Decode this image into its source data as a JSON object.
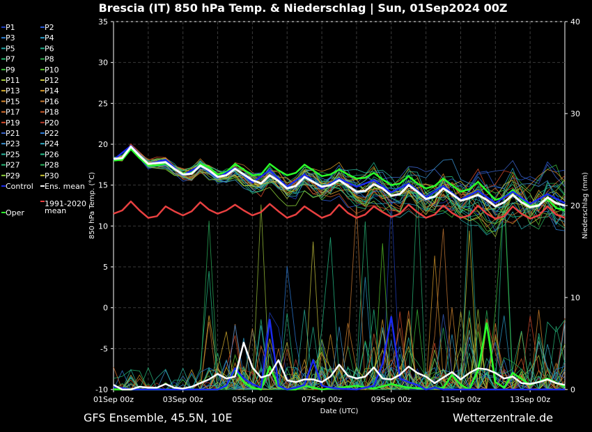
{
  "chart_data": {
    "type": "line",
    "title": "Brescia  (IT)  850 hPa Temp. & Niederschlag | Sun, 01Sep2024 00Z",
    "xlabel": "Date (UTC)",
    "ylabel": "850 hPa Temp. (°C)",
    "y2label": "Niederschlag (mm)",
    "footer_left": "GFS Ensemble, 45.5N, 10E",
    "footer_right": "Wetterzentrale.de",
    "x_ticks": [
      "01Sep 00z",
      "03Sep 00z",
      "05Sep 00z",
      "07Sep 00z",
      "09Sep 00z",
      "11Sep 00z",
      "13Sep 00z"
    ],
    "y_ticks": [
      "35",
      "30",
      "25",
      "20",
      "15",
      "10",
      "5",
      "0",
      "-5",
      "-10"
    ],
    "y2_ticks": [
      "40",
      "30",
      "20",
      "10",
      "0"
    ],
    "ylim": [
      -10,
      35
    ],
    "y2lim": [
      0,
      40
    ],
    "grid": true,
    "legend": [
      {
        "name": "P1",
        "color": "#1f3fbf"
      },
      {
        "name": "P2",
        "color": "#2a5ad8"
      },
      {
        "name": "P3",
        "color": "#2e7fd6"
      },
      {
        "name": "P4",
        "color": "#2a9bc8"
      },
      {
        "name": "P5",
        "color": "#23a8a8"
      },
      {
        "name": "P6",
        "color": "#22b28c"
      },
      {
        "name": "P7",
        "color": "#26b870"
      },
      {
        "name": "P8",
        "color": "#2aa84a"
      },
      {
        "name": "P9",
        "color": "#3cc23c"
      },
      {
        "name": "P10",
        "color": "#5ac82a"
      },
      {
        "name": "P11",
        "color": "#9cc43a"
      },
      {
        "name": "P12",
        "color": "#c4c23c"
      },
      {
        "name": "P13",
        "color": "#d8b030"
      },
      {
        "name": "P14",
        "color": "#d89a2a"
      },
      {
        "name": "P15",
        "color": "#d8882e"
      },
      {
        "name": "P16",
        "color": "#c87a34"
      },
      {
        "name": "P17",
        "color": "#d8702e"
      },
      {
        "name": "P18",
        "color": "#c85a2a"
      },
      {
        "name": "P19",
        "color": "#d84a2a"
      },
      {
        "name": "P20",
        "color": "#b83a2a"
      },
      {
        "name": "P21",
        "color": "#3a62c8"
      },
      {
        "name": "P22",
        "color": "#2a7ad8"
      },
      {
        "name": "P23",
        "color": "#3a90d0"
      },
      {
        "name": "P24",
        "color": "#30a8c0"
      },
      {
        "name": "P25",
        "color": "#2ab8a0"
      },
      {
        "name": "P26",
        "color": "#26c08a"
      },
      {
        "name": "P27",
        "color": "#28b878"
      },
      {
        "name": "P28",
        "color": "#2ab05a"
      },
      {
        "name": "P29",
        "color": "#8cd03a"
      },
      {
        "name": "P30",
        "color": "#c8c030"
      },
      {
        "name": "Control",
        "color": "#1a2af0"
      },
      {
        "name": "Ens. mean",
        "color": "#ffffff"
      },
      {
        "name": "Oper",
        "color": "#2aff2a"
      },
      {
        "name": "1991-2020 mean",
        "color": "#e84040"
      }
    ],
    "series": [
      {
        "name": "Ens. mean",
        "color": "#ffffff",
        "axis": "temp",
        "x": [
          0,
          0.25,
          0.5,
          0.75,
          1,
          1.25,
          1.5,
          1.75,
          2,
          2.25,
          2.5,
          2.75,
          3,
          3.25,
          3.5,
          3.75,
          4,
          4.25,
          4.5,
          4.75,
          5,
          5.25,
          5.5,
          5.75,
          6,
          6.25,
          6.5,
          6.75,
          7,
          7.25,
          7.5,
          7.75,
          8,
          8.25,
          8.5,
          8.75,
          9,
          9.25,
          9.5,
          9.75,
          10,
          10.25,
          10.5,
          10.75,
          11,
          11.25,
          11.5,
          11.75,
          12,
          12.25,
          12.5,
          12.75,
          13
        ],
        "values": [
          18.2,
          18.3,
          19.7,
          18.6,
          17.6,
          17.7,
          17.8,
          17,
          16.3,
          16.4,
          17.4,
          16.8,
          16,
          16.2,
          17,
          16.3,
          15.6,
          15.2,
          16.2,
          15.5,
          14.6,
          14.9,
          16,
          15.4,
          14.8,
          15,
          15.6,
          14.9,
          14.2,
          14.3,
          15.1,
          14.6,
          13.7,
          13.9,
          15,
          14.2,
          13.3,
          13.6,
          14.6,
          13.9,
          13.1,
          13.4,
          13.8,
          13.2,
          12.4,
          12.9,
          13.8,
          12.9,
          12.3,
          12.5,
          13.5,
          12.8,
          12.5
        ]
      },
      {
        "name": "1991-2020 mean",
        "color": "#e84040",
        "axis": "temp",
        "x": [
          0,
          0.25,
          0.5,
          0.75,
          1,
          1.25,
          1.5,
          1.75,
          2,
          2.25,
          2.5,
          2.75,
          3,
          3.25,
          3.5,
          3.75,
          4,
          4.25,
          4.5,
          4.75,
          5,
          5.25,
          5.5,
          5.75,
          6,
          6.25,
          6.5,
          6.75,
          7,
          7.25,
          7.5,
          7.75,
          8,
          8.25,
          8.5,
          8.75,
          9,
          9.25,
          9.5,
          9.75,
          10,
          10.25,
          10.5,
          10.75,
          11,
          11.25,
          11.5,
          11.75,
          12,
          12.25,
          12.5,
          12.75,
          13
        ],
        "values": [
          11.5,
          11.9,
          13,
          11.9,
          11,
          11.2,
          12.4,
          11.8,
          11.3,
          11.8,
          12.9,
          12,
          11.5,
          11.9,
          12.6,
          11.9,
          11.3,
          11.7,
          12.7,
          11.8,
          11,
          11.4,
          12.4,
          11.7,
          11,
          11.4,
          12.6,
          11.6,
          11,
          11.4,
          12.4,
          11.7,
          11.1,
          11.5,
          12.6,
          11.7,
          11,
          11.4,
          12.5,
          11.6,
          11,
          11.3,
          12.5,
          11.5,
          10.9,
          11.2,
          12.4,
          11.5,
          10.9,
          11.3,
          12.4,
          11.4,
          11
        ]
      },
      {
        "name": "Oper",
        "color": "#2aff2a",
        "axis": "temp",
        "x": [
          0,
          0.25,
          0.5,
          0.75,
          1,
          1.25,
          1.5,
          1.75,
          2,
          2.25,
          2.5,
          2.75,
          3,
          3.25,
          3.5,
          3.75,
          4,
          4.25,
          4.5,
          4.75,
          5,
          5.25,
          5.5,
          5.75,
          6,
          6.25,
          6.5,
          6.75,
          7,
          7.25,
          7.5,
          7.75,
          8,
          8.25,
          8.5,
          8.75,
          9,
          9.25,
          9.5,
          9.75,
          10,
          10.25,
          10.5,
          10.75,
          11,
          11.25,
          11.5,
          11.75,
          12,
          12.25,
          12.5,
          12.75,
          13
        ],
        "values": [
          18,
          18.1,
          19.4,
          18.3,
          17.4,
          17.4,
          17.7,
          16.9,
          16.4,
          16.6,
          17.6,
          17.2,
          16.3,
          16.6,
          17.6,
          16.9,
          16.2,
          16.3,
          17.6,
          16.8,
          16.2,
          16.5,
          17.5,
          16.8,
          16.1,
          16.3,
          16.9,
          16.3,
          15.8,
          15.9,
          16.5,
          15.7,
          15,
          15.2,
          16.1,
          15.2,
          14.6,
          14.9,
          15.8,
          15,
          14.2,
          14.5,
          15.4,
          14.3,
          13.2,
          13.5,
          14.4,
          13.3,
          12.4,
          12.6,
          13.3,
          12.2,
          11.9
        ]
      },
      {
        "name": "Control",
        "color": "#1a2af0",
        "axis": "temp",
        "x": [
          0,
          0.5,
          1,
          1.5,
          2,
          2.5,
          3,
          3.5,
          4,
          4.5,
          5,
          5.5,
          6,
          6.5,
          7,
          7.5,
          8,
          8.5,
          9,
          9.5,
          10,
          10.5,
          11,
          11.5,
          12,
          12.5,
          13
        ],
        "values": [
          18.1,
          19.8,
          17.6,
          18.1,
          16.2,
          17.4,
          15.9,
          17.1,
          15.3,
          16.8,
          14.8,
          16.3,
          14.6,
          15.8,
          14.8,
          15.6,
          14.1,
          15.2,
          13.5,
          14.9,
          13.2,
          14.3,
          12.8,
          14.2,
          12.7,
          13.9,
          12.8
        ]
      },
      {
        "name": "Ens. mean precip",
        "color": "#ffffff",
        "axis": "precip",
        "x": [
          0,
          0.25,
          0.5,
          0.75,
          1,
          1.25,
          1.5,
          1.75,
          2,
          2.25,
          2.5,
          2.75,
          3,
          3.25,
          3.5,
          3.75,
          4,
          4.25,
          4.5,
          4.75,
          5,
          5.25,
          5.5,
          5.75,
          6,
          6.25,
          6.5,
          6.75,
          7,
          7.25,
          7.5,
          7.75,
          8,
          8.25,
          8.5,
          8.75,
          9,
          9.25,
          9.5,
          9.75,
          10,
          10.25,
          10.5,
          10.75,
          11,
          11.25,
          11.5,
          11.75,
          12,
          12.25,
          12.5,
          12.75,
          13
        ],
        "values": [
          0.5,
          0,
          0,
          0.3,
          0.2,
          0.2,
          0.6,
          0.2,
          0.1,
          0.3,
          0.7,
          1.1,
          1.7,
          1.2,
          1.4,
          5.1,
          2.4,
          1.3,
          1.6,
          3.2,
          1,
          0.8,
          1.1,
          1.1,
          0.8,
          1.4,
          2.7,
          1.5,
          1.2,
          1.4,
          2.4,
          1.2,
          1.1,
          1.6,
          2.5,
          1.8,
          1.4,
          0.7,
          1.3,
          1.9,
          1.1,
          1.8,
          2.3,
          2.2,
          1.8,
          1.2,
          1.4,
          0.7,
          0.6,
          0.8,
          1.1,
          0.7,
          0.5
        ]
      },
      {
        "name": "Control precip",
        "color": "#1a2af0",
        "axis": "precip",
        "x": [
          0,
          0.5,
          1,
          1.5,
          2,
          2.5,
          3,
          3.25,
          3.5,
          3.75,
          4,
          4.25,
          4.5,
          4.75,
          5,
          5.25,
          5.5,
          5.75,
          6,
          6.25,
          6.5,
          7,
          7.5,
          7.75,
          8,
          8.25,
          8.5,
          8.75,
          9,
          9.25,
          9.5,
          10,
          10.5,
          11,
          11.5,
          12,
          12.5,
          13
        ],
        "values": [
          0.3,
          0,
          0,
          0,
          0,
          0,
          0,
          0.4,
          2.3,
          1.2,
          0.6,
          0.2,
          7.6,
          0.4,
          0,
          0.2,
          0.5,
          3.2,
          0.4,
          0.2,
          0.1,
          0,
          0.4,
          2.8,
          7.9,
          1.2,
          0.8,
          0.5,
          0,
          0.2,
          0,
          0,
          0,
          0,
          0,
          0,
          0,
          0
        ]
      },
      {
        "name": "Oper precip",
        "color": "#2aff2a",
        "axis": "precip",
        "x": [
          0,
          0.5,
          1,
          1.5,
          2,
          2.5,
          3,
          3.25,
          3.5,
          3.75,
          4,
          4.25,
          4.5,
          4.75,
          5,
          5.25,
          5.5,
          5.75,
          6,
          6.5,
          7,
          7.5,
          8,
          8.5,
          9,
          9.5,
          9.75,
          10,
          10.25,
          10.5,
          10.75,
          11,
          11.25,
          11.5,
          12,
          12.5,
          13
        ],
        "values": [
          0,
          0,
          0,
          0,
          0,
          0,
          0,
          0.3,
          2.2,
          0.8,
          0.2,
          0,
          2.5,
          0.3,
          0,
          0,
          0.4,
          0.2,
          0,
          0.2,
          0.4,
          0.1,
          0.6,
          0.2,
          0.1,
          0.2,
          1.6,
          0.5,
          0,
          2.1,
          7.2,
          0.8,
          0.2,
          1.8,
          0.5,
          1.2,
          0.3
        ]
      }
    ]
  }
}
